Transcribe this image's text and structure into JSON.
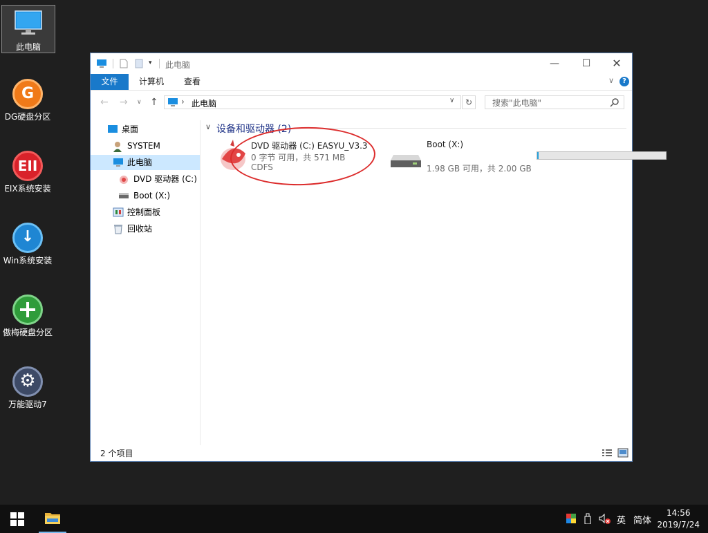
{
  "desktop": {
    "icons": [
      {
        "label": "此电脑",
        "icon": "computer-icon"
      },
      {
        "label": "DG硬盘分区",
        "icon": "dg-partition-icon"
      },
      {
        "label": "EIX系统安装",
        "icon": "eix-install-icon"
      },
      {
        "label": "Win系统安装",
        "icon": "win-install-icon"
      },
      {
        "label": "傲梅硬盘分区",
        "icon": "aomei-partition-icon"
      },
      {
        "label": "万能驱动7",
        "icon": "driver-gear-icon"
      }
    ]
  },
  "window": {
    "title": "此电脑",
    "ribbon_tabs": [
      "文件",
      "计算机",
      "查看"
    ],
    "address": {
      "path": "此电脑"
    },
    "search": {
      "placeholder": "搜索\"此电脑\""
    },
    "nav": [
      {
        "label": "桌面",
        "icon": "desktop-icon"
      },
      {
        "label": "SYSTEM",
        "icon": "user-icon"
      },
      {
        "label": "此电脑",
        "icon": "computer-icon",
        "selected": true
      },
      {
        "label": "DVD 驱动器 (C:) E",
        "icon": "dvd-drive-icon"
      },
      {
        "label": "Boot (X:)",
        "icon": "hard-drive-icon"
      },
      {
        "label": "控制面板",
        "icon": "control-panel-icon"
      },
      {
        "label": "回收站",
        "icon": "recycle-bin-icon"
      }
    ],
    "group": {
      "label": "设备和驱动器 (2)"
    },
    "drives": [
      {
        "name": "DVD 驱动器 (C:) EASYU_V3.3",
        "space": "0 字节 可用，共 571 MB",
        "fs": "CDFS",
        "icon": "dvd-drive-icon"
      },
      {
        "name": "Boot (X:)",
        "space": "1.98 GB 可用，共 2.00 GB",
        "used_fraction": 0.01,
        "icon": "hard-drive-icon"
      }
    ],
    "status": {
      "item_count": "2 个项目"
    }
  },
  "taskbar": {
    "ime": "英",
    "ime_mode": "简体",
    "time": "14:56",
    "date": "2019/7/24"
  },
  "colors": {
    "accent": "#1979ca",
    "selection": "#cce8ff",
    "annotation": "#dc2c2c",
    "group_header": "#1e3287"
  }
}
